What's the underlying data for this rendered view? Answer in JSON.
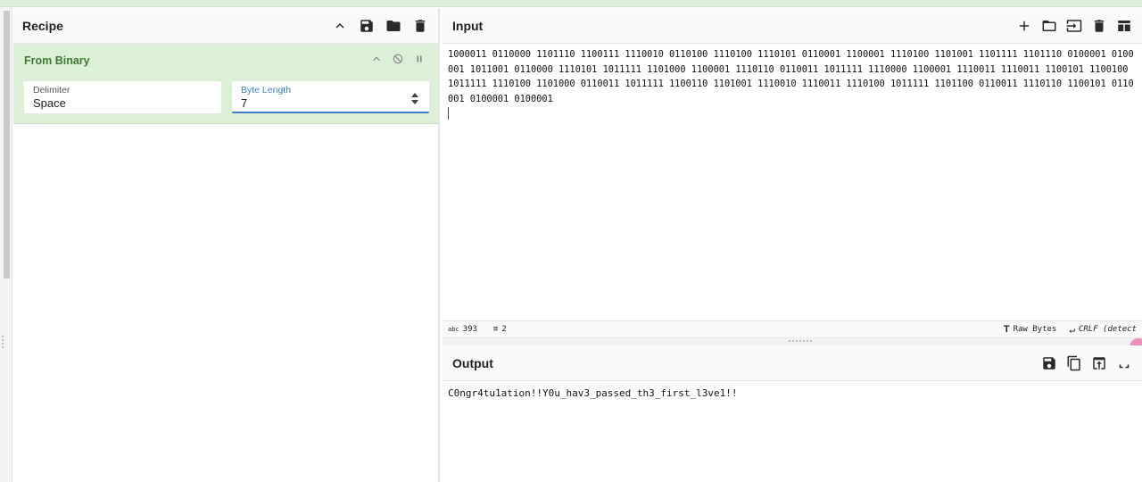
{
  "recipe": {
    "title": "Recipe",
    "operation": {
      "name": "From Binary",
      "delimiter_label": "Delimiter",
      "delimiter_value": "Space",
      "byte_length_label": "Byte Length",
      "byte_length_value": "7"
    }
  },
  "input": {
    "title": "Input",
    "text": "1000011 0110000 1101110 1100111 1110010 0110100 1110100 1110101 0110001 1100001 1110100 1101001 1101111 1101110 0100001 0100001 1011001 0110000 1110101 1011111 1101000 1100001 1110110 0110011 1011111 1110000 1100001 1110011 1110011 1100101 1100100 1011111 1110100 1101000 0110011 1011111 1100110 1101001 1110010 1110011 1110100 1011111 1101100 0110011 1110110 1100101 0110001 0100001 0100001"
  },
  "status": {
    "chars": "393",
    "lines": "2",
    "encoding": "Raw Bytes",
    "eol": "CRLF (detect"
  },
  "output": {
    "title": "Output",
    "text": "C0ngr4tu1ation!!Y0u_hav3_passed_th3_first_l3ve1!!"
  },
  "colors": {
    "operation_bg": "#dcefd7",
    "operation_title": "#3c7a33",
    "active_field": "#3f7fc6"
  },
  "icons": [
    "chevron-up-icon",
    "save-icon",
    "folder-icon",
    "trash-icon",
    "plus-icon",
    "input-icon",
    "table-icon",
    "disable-icon",
    "pause-icon",
    "copy-icon",
    "replace-icon",
    "maximise-icon",
    "text-format-icon",
    "return-icon",
    "lines-icon"
  ]
}
